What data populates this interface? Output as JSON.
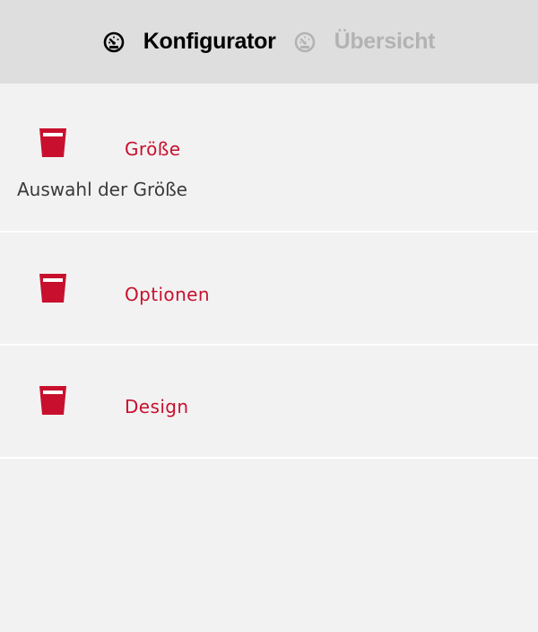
{
  "header": {
    "tabs": [
      {
        "label": "Konfigurator",
        "icon": "gauge-icon",
        "active": true
      },
      {
        "label": "Übersicht",
        "icon": "gauge-icon",
        "active": false
      }
    ]
  },
  "sections": [
    {
      "title": "Größe",
      "description": "Auswahl der Größe",
      "icon": "cup-icon"
    },
    {
      "title": "Optionen",
      "icon": "cup-icon"
    },
    {
      "title": "Design",
      "icon": "cup-icon"
    }
  ],
  "colors": {
    "accent": "#c8102e",
    "header_bg": "#dedede",
    "page_bg": "#f2f2f2",
    "inactive_tab": "#b3b3b3",
    "divider": "#ffffff"
  }
}
